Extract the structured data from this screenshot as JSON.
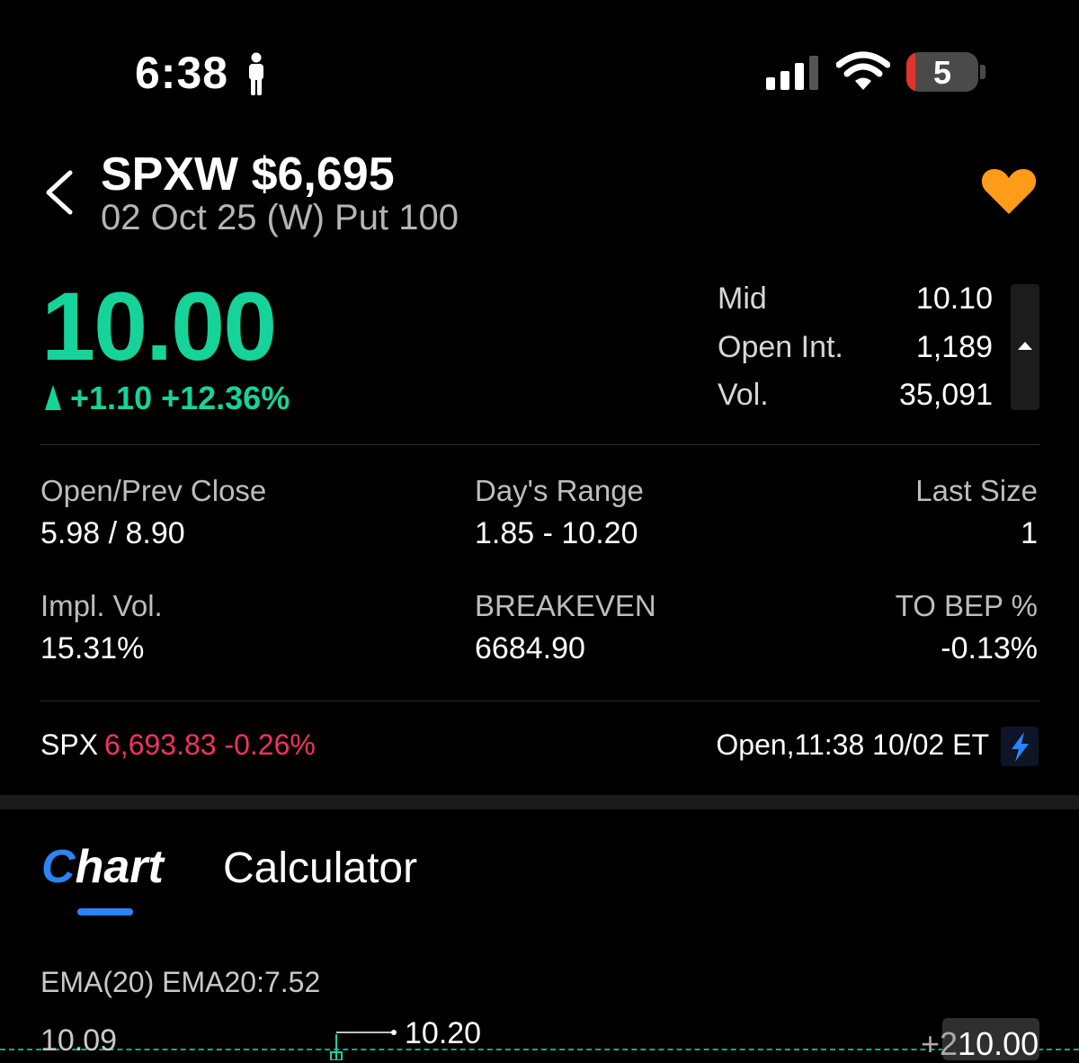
{
  "status_bar": {
    "time": "6:38",
    "battery": "5"
  },
  "header": {
    "symbol": "SPXW $6,695",
    "subtitle": "02 Oct 25 (W) Put 100",
    "favorite_icon": "heart-icon",
    "favorite_color": "#ff9c1a"
  },
  "quote": {
    "last": "10.00",
    "change": "+1.10 +12.36%",
    "stats": [
      {
        "label": "Mid",
        "value": "10.10"
      },
      {
        "label": "Open Int.",
        "value": "1,189"
      },
      {
        "label": "Vol.",
        "value": "35,091"
      }
    ]
  },
  "details": {
    "open_prev_close": {
      "label": "Open/Prev Close",
      "value": "5.98 / 8.90"
    },
    "days_range": {
      "label": "Day's Range",
      "value": "1.85 - 10.20"
    },
    "last_size": {
      "label": "Last Size",
      "value": "1"
    },
    "impl_vol": {
      "label": "Impl. Vol.",
      "value": "15.31%"
    },
    "breakeven": {
      "label": "BREAKEVEN",
      "value": "6684.90"
    },
    "to_bep": {
      "label": "TO BEP %",
      "value": "-0.13%"
    }
  },
  "underlying": {
    "label": "SPX",
    "value": "6,693.83 -0.26%",
    "market_status": "Open,11:38 10/02 ET"
  },
  "tabs": {
    "chart_first": "C",
    "chart_rest": "hart",
    "calculator": "Calculator"
  },
  "chart": {
    "ema_label": "EMA(20)  EMA20:7.52",
    "left_value": "10.09",
    "high_value": "10.20",
    "right_value": "10.00",
    "right_prefix": "+2"
  },
  "colors": {
    "up": "#16d39a",
    "down": "#f2335d",
    "accent": "#2b84f6"
  }
}
